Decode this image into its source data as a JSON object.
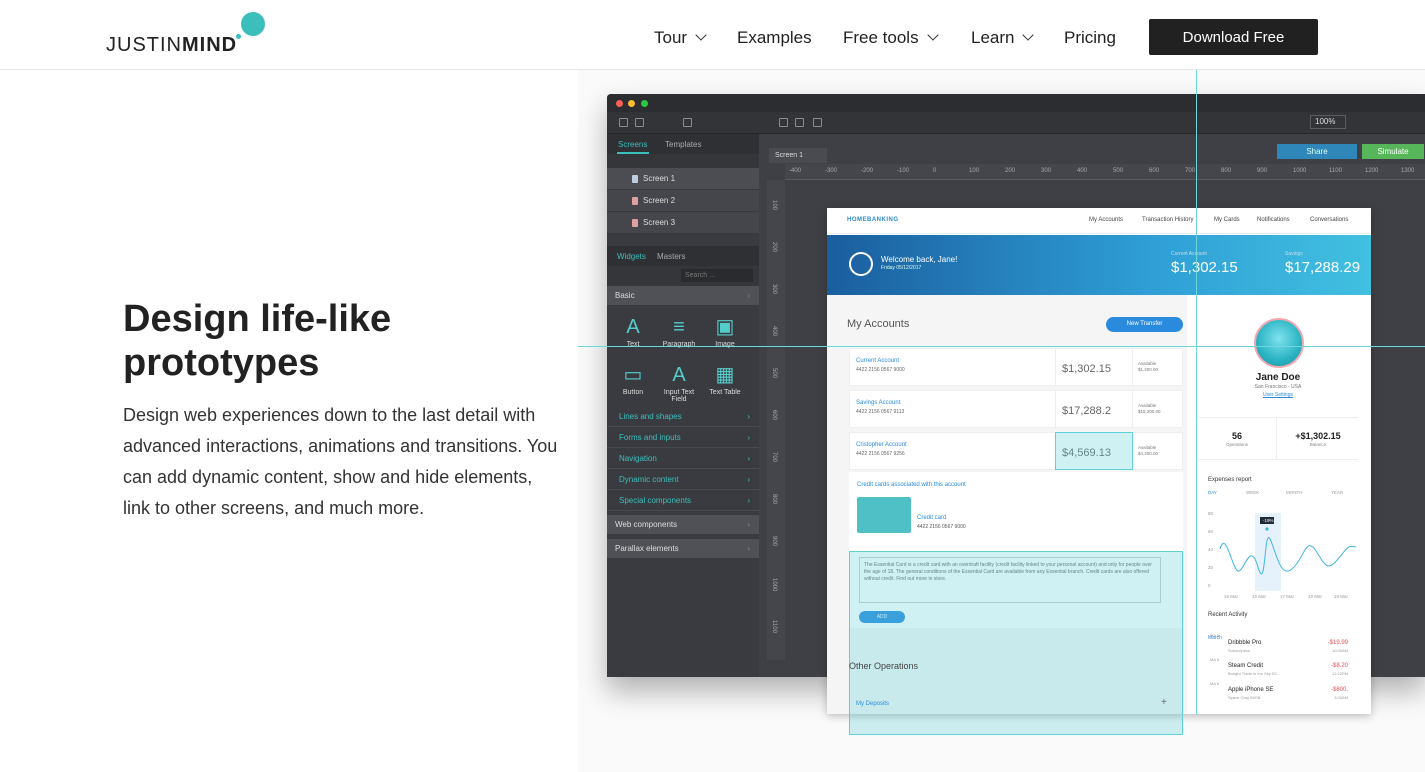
{
  "header": {
    "logo_light": "JUSTIN",
    "logo_bold": "MIND",
    "nav": [
      {
        "label": "Tour",
        "dropdown": true
      },
      {
        "label": "Examples",
        "dropdown": false
      },
      {
        "label": "Free tools",
        "dropdown": true
      },
      {
        "label": "Learn",
        "dropdown": true
      },
      {
        "label": "Pricing",
        "dropdown": false
      }
    ],
    "cta": "Download Free"
  },
  "hero": {
    "title": "Design life-like prototypes",
    "body": "Design web experiences down to the last detail with advanced interactions, animations and transitions. You can add dynamic content, show and hide elements, link to other screens, and much more."
  },
  "app": {
    "zoom": "100%",
    "tabs": [
      "Screens",
      "Templates"
    ],
    "screens": [
      "Screen 1",
      "Screen 2",
      "Screen 3"
    ],
    "widget_tabs": [
      "Widgets",
      "Masters"
    ],
    "search_placeholder": "Search ...",
    "basic": "Basic",
    "widgets": [
      "Text",
      "Paragraph",
      "Image",
      "Button",
      "Input Text Field",
      "Text Table"
    ],
    "subcategories": [
      "Lines and shapes",
      "Forms and inputs",
      "Navigation",
      "Dynamic content",
      "Special components"
    ],
    "categories": [
      "Web components",
      "Parallax elements"
    ],
    "canvas_tab": "Screen 1",
    "share": "Share",
    "simulate": "Simulate",
    "ruler_h": [
      "-400",
      "-300",
      "-200",
      "-100",
      "0",
      "100",
      "200",
      "300",
      "400",
      "500",
      "600",
      "700",
      "800",
      "900",
      "1000",
      "1100",
      "1200",
      "1300"
    ],
    "ruler_v": [
      "100",
      "200",
      "300",
      "400",
      "500",
      "600",
      "700",
      "800",
      "900",
      "1000",
      "1100"
    ]
  },
  "mock": {
    "logo": "HOMEBANKING",
    "nav": [
      "My Accounts",
      "Transaction History",
      "My Cards",
      "Notifications",
      "Conversations"
    ],
    "welcome": "Welcome back, Jane!",
    "date": "Friday 05/12/2017",
    "current_label": "Current Account",
    "current_balance": "$1,302.15",
    "savings_label": "Savings",
    "savings_balance": "$17,288.29",
    "accounts_title": "My Accounts",
    "new_transfer": "New Transfer",
    "accounts": [
      {
        "name": "Current Account",
        "number": "4422 2156 0567 9000",
        "amount": "$1,302.15",
        "avail": "Available",
        "avail_amt": "$1,200.00"
      },
      {
        "name": "Savings Account",
        "number": "4422 2156 0567 9113",
        "amount": "$17,288.2",
        "avail": "Available",
        "avail_amt": "$15,200.00"
      },
      {
        "name": "Cristopher Account",
        "number": "4422 2156 0567 9256",
        "amount": "$4,569.13",
        "avail": "Available",
        "avail_amt": "$4,200.00"
      }
    ],
    "cards_title": "Credit cards associated with this account",
    "card_label": "Credit card",
    "card_number": "4422 2156 0567 9000",
    "note": "The Essential Card is a credit card with an overdraft facility (credit facility linked to your personal account) and only for people over the age of 18. The general conditions of the Essential Card are available from any Essential branch. Credit cards are also offered without credit. Find out more in store.",
    "add": "ADD",
    "other_ops": "Other Operations",
    "deposits": "My Deposits",
    "user_name": "Jane Doe",
    "user_location": "San Francisco - USA",
    "user_settings": "User Settings",
    "ops_count": "56",
    "ops_label": "Operations",
    "balance_value": "+$1,302.15",
    "balance_label": "Balance",
    "expenses": "Expenses report",
    "ranges": [
      "DAY",
      "WEEK",
      "MONTH",
      "YEAR"
    ],
    "chart_tag": "-19%",
    "chart_y": [
      "80",
      "60",
      "40",
      "20",
      "0"
    ],
    "chart_x": [
      "15 Mar",
      "16 Mar",
      "17 Mar",
      "18 Mar",
      "19 Mar"
    ],
    "recent": "Recent Activity",
    "month": "March",
    "activity": [
      {
        "date": "MA 5",
        "name": "Dribbble Pro",
        "sub": "Subscription",
        "amount": "-$19.99",
        "time": "10:00AM"
      },
      {
        "date": "MA 5",
        "name": "Steam Credit",
        "sub": "Bought Trade in the Sky SC",
        "amount": "-$8.20",
        "time": "12:22PM"
      },
      {
        "date": "MA 6",
        "name": "Apple iPhone SE",
        "sub": "Space Gray 64GB",
        "amount": "-$800.",
        "time": "3:00AM"
      }
    ]
  },
  "colors": {
    "accent": "#3cbfbb",
    "cta": "#212121",
    "share": "#2f86b9",
    "simulate": "#57b55a"
  }
}
